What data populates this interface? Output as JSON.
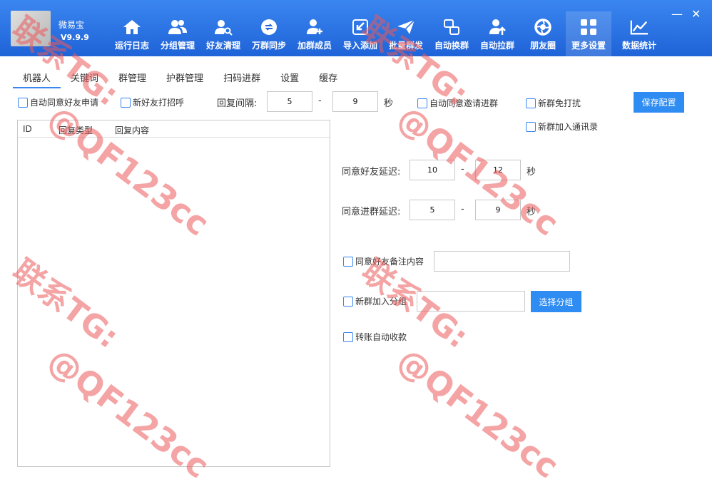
{
  "app": {
    "name": "微易宝",
    "version": "V9.9.9"
  },
  "nav": [
    {
      "label": "运行日志",
      "icon": "home-icon"
    },
    {
      "label": "分组管理",
      "icon": "users-icon"
    },
    {
      "label": "好友清理",
      "icon": "user-search-icon"
    },
    {
      "label": "万群同步",
      "icon": "sync-icon"
    },
    {
      "label": "加群成员",
      "icon": "user-add-icon"
    },
    {
      "label": "导入添加",
      "icon": "import-icon"
    },
    {
      "label": "批量群发",
      "icon": "send-icon"
    },
    {
      "label": "自动换群",
      "icon": "swap-icon"
    },
    {
      "label": "自动拉群",
      "icon": "user-up-icon"
    },
    {
      "label": "朋友圈",
      "icon": "aperture-icon"
    },
    {
      "label": "更多设置",
      "icon": "grid-icon",
      "active": true
    },
    {
      "label": "数据统计",
      "icon": "chart-icon"
    }
  ],
  "window": {
    "minimize": "—",
    "close": "✕"
  },
  "tabs": [
    "机器人",
    "关键词",
    "群管理",
    "护群管理",
    "扫码进群",
    "设置",
    "缓存"
  ],
  "row1": {
    "auto_accept_friend": "自动同意好友申请",
    "greet_new_friend": "新好友打招呼",
    "reply_interval_label": "回复间隔:",
    "reply_min": "5",
    "dash": "-",
    "reply_max": "9",
    "seconds": "秒",
    "auto_accept_invite": "自动同意邀请进群",
    "new_group_no_disturb": "新群免打扰",
    "save_button": "保存配置"
  },
  "new_group_contacts": "新群加入通讯录",
  "table": {
    "columns": [
      "ID",
      "回复类型",
      "回复内容"
    ]
  },
  "friend_delay": {
    "label": "同意好友延迟:",
    "min": "10",
    "dash": "-",
    "max": "12",
    "unit": "秒"
  },
  "group_delay": {
    "label": "同意进群延迟:",
    "min": "5",
    "dash": "-",
    "max": "9",
    "unit": "秒"
  },
  "friend_note": {
    "label": "同意好友备注内容",
    "value": ""
  },
  "new_group_group": {
    "label": "新群加入分组",
    "value": "",
    "button": "选择分组"
  },
  "auto_receive": "转账自动收款",
  "watermark": {
    "line1": "联系TG:",
    "line2": "@QF123cc"
  }
}
